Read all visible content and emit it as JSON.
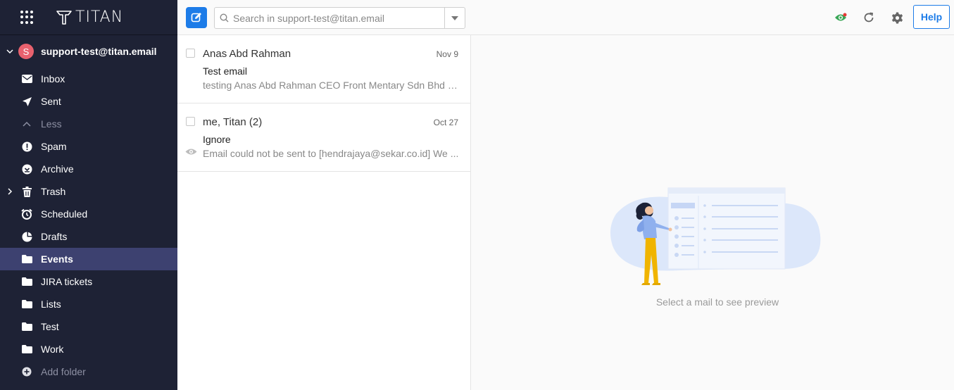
{
  "brand": {
    "name": "TITAN"
  },
  "account": {
    "initial": "S",
    "email": "support-test@titan.email",
    "avatar_color": "#e8616e"
  },
  "folders": [
    {
      "label": "Inbox",
      "icon": "inbox-icon"
    },
    {
      "label": "Sent",
      "icon": "send-icon"
    },
    {
      "label": "Less",
      "icon": "chevron-up-icon"
    },
    {
      "label": "Spam",
      "icon": "alert-icon"
    },
    {
      "label": "Archive",
      "icon": "archive-icon"
    },
    {
      "label": "Trash",
      "icon": "trash-icon"
    },
    {
      "label": "Scheduled",
      "icon": "alarm-clock-icon"
    },
    {
      "label": "Drafts",
      "icon": "draft-icon"
    },
    {
      "label": "Events",
      "icon": "folder-icon"
    },
    {
      "label": "JIRA tickets",
      "icon": "folder-icon"
    },
    {
      "label": "Lists",
      "icon": "folder-icon"
    },
    {
      "label": "Test",
      "icon": "folder-icon"
    },
    {
      "label": "Work",
      "icon": "folder-icon"
    },
    {
      "label": "Add folder",
      "icon": "add-icon"
    }
  ],
  "active_folder": "Events",
  "search": {
    "placeholder": "Search in support-test@titan.email"
  },
  "toolbar": {
    "help_label": "Help"
  },
  "mails": [
    {
      "sender": "Anas Abd Rahman",
      "date": "Nov 9",
      "subject": "Test email",
      "snippet": "testing Anas Abd Rahman CEO Front Mentary Sdn Bhd (1..."
    },
    {
      "sender": "me, Titan (2)",
      "date": "Oct 27",
      "subject": "Ignore",
      "snippet": "Email could not be sent to [hendrajaya@sekar.co.id] We ..."
    }
  ],
  "preview": {
    "empty_text": "Select a mail to see preview"
  },
  "colors": {
    "sidebar_bg": "#1e2235",
    "active_bg": "#3d4170",
    "accent": "#1d7ce8"
  }
}
